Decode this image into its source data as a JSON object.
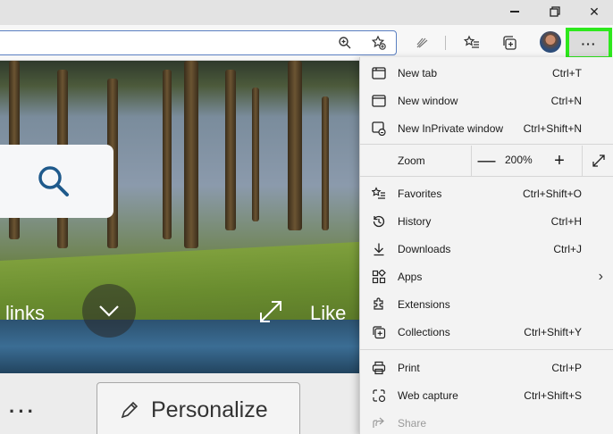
{
  "window": {
    "min": "",
    "max": "",
    "close": "✕"
  },
  "toolbar": {
    "more_label": "···"
  },
  "background": {
    "links_label": "links",
    "like_label": "Like"
  },
  "bottom": {
    "dots": "···",
    "personalize_label": "Personalize"
  },
  "menu": {
    "items": [
      {
        "label": "New tab",
        "shortcut": "Ctrl+T",
        "icon": "new-tab-icon"
      },
      {
        "label": "New window",
        "shortcut": "Ctrl+N",
        "icon": "new-window-icon"
      },
      {
        "label": "New InPrivate window",
        "shortcut": "Ctrl+Shift+N",
        "icon": "inprivate-icon"
      },
      {
        "label": "Favorites",
        "shortcut": "Ctrl+Shift+O",
        "icon": "favorites-icon"
      },
      {
        "label": "History",
        "shortcut": "Ctrl+H",
        "icon": "history-icon"
      },
      {
        "label": "Downloads",
        "shortcut": "Ctrl+J",
        "icon": "downloads-icon"
      },
      {
        "label": "Apps",
        "shortcut": "",
        "icon": "apps-icon"
      },
      {
        "label": "Extensions",
        "shortcut": "",
        "icon": "extensions-icon"
      },
      {
        "label": "Collections",
        "shortcut": "Ctrl+Shift+Y",
        "icon": "collections-icon"
      },
      {
        "label": "Print",
        "shortcut": "Ctrl+P",
        "icon": "print-icon"
      },
      {
        "label": "Web capture",
        "shortcut": "Ctrl+Shift+S",
        "icon": "web-capture-icon"
      },
      {
        "label": "Share",
        "shortcut": "",
        "icon": "share-icon"
      }
    ],
    "zoom": {
      "label": "Zoom",
      "minus": "—",
      "value": "200%",
      "plus": "+"
    }
  },
  "colors": {
    "highlight": "#2ee81d",
    "accent": "#5a7fc2"
  }
}
